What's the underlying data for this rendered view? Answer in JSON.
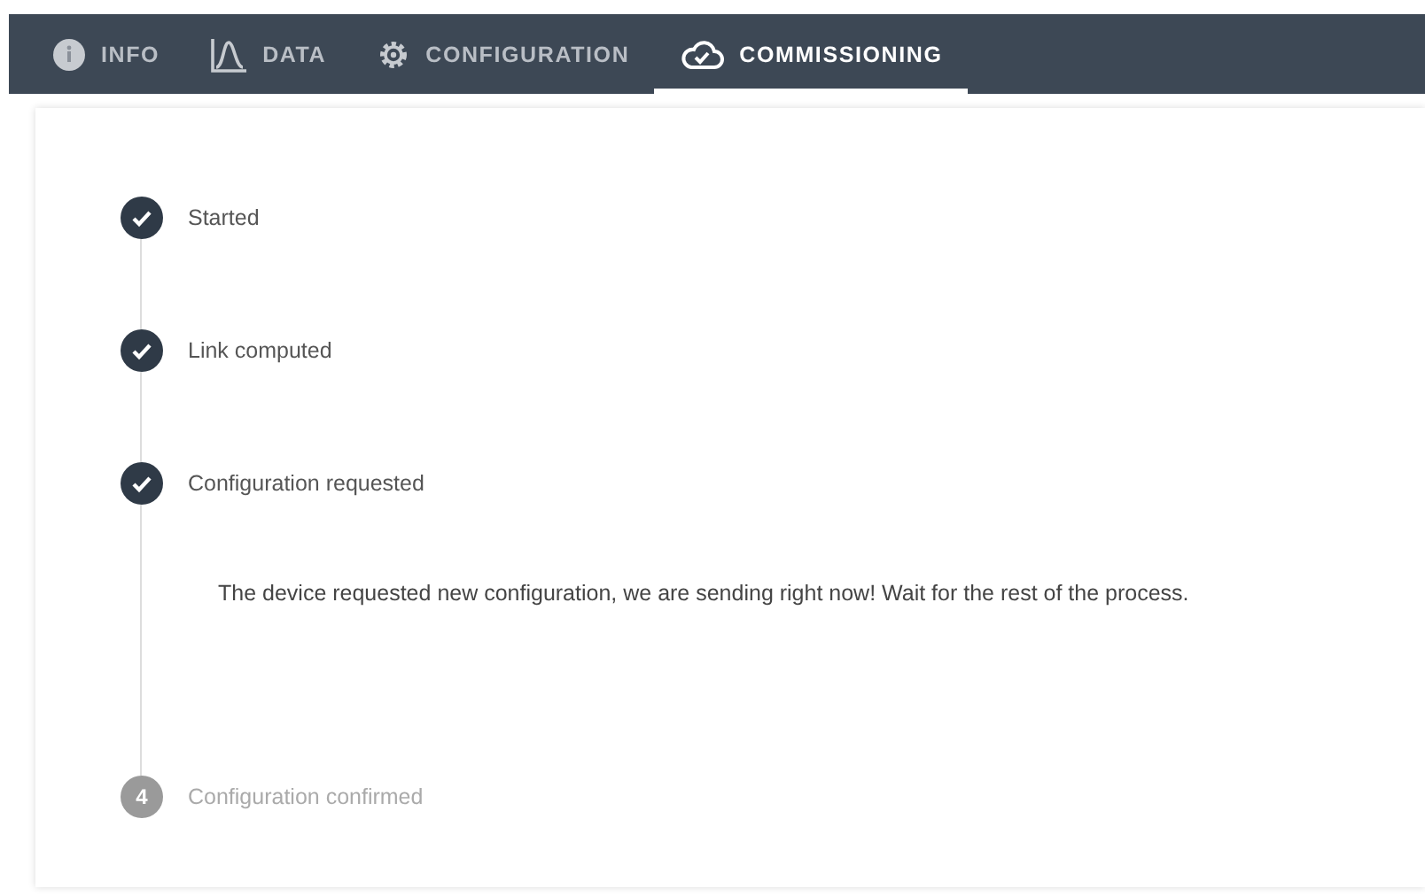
{
  "tabs": [
    {
      "label": "INFO",
      "selected": false
    },
    {
      "label": "DATA",
      "selected": false
    },
    {
      "label": "CONFIGURATION",
      "selected": false
    },
    {
      "label": "COMMISSIONING",
      "selected": true
    }
  ],
  "steps": [
    {
      "label": "Started",
      "done": true
    },
    {
      "label": "Link computed",
      "done": true
    },
    {
      "label": "Configuration requested",
      "done": true,
      "description": "The device requested new configuration, we are sending right now! Wait for the rest of the process."
    },
    {
      "label": "Configuration confirmed",
      "done": false,
      "number": "4"
    }
  ]
}
